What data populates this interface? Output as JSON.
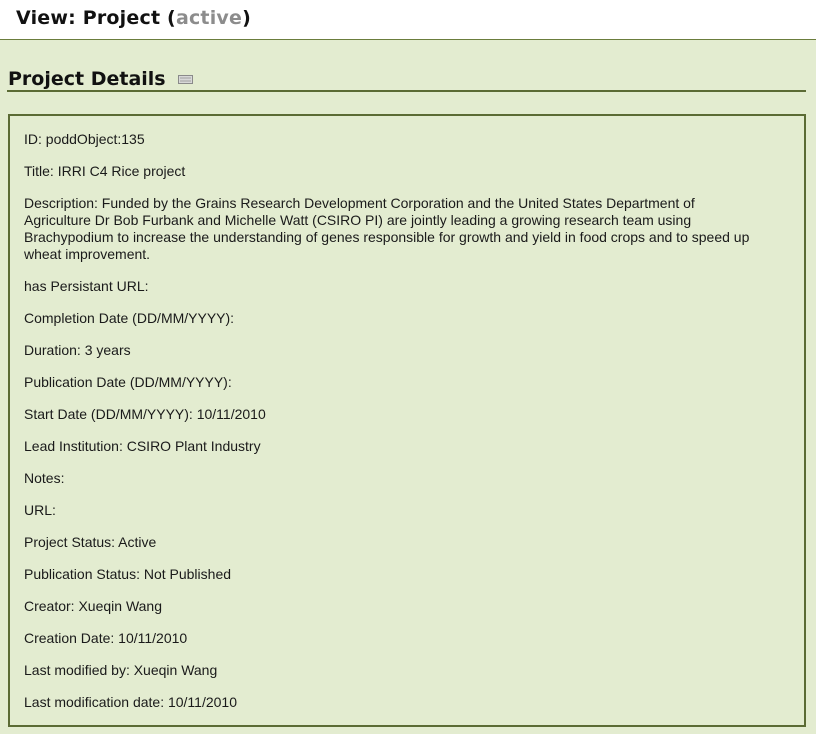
{
  "header": {
    "view_prefix": "View: Project (",
    "status": "active",
    "view_suffix": ")"
  },
  "section": {
    "title": "Project Details",
    "icon": "collapse-icon"
  },
  "details": {
    "id": "ID: poddObject:135",
    "title": "Title: IRRI C4 Rice project",
    "description_line1": "Description: Funded by the Grains Research Development Corporation and the United States Department of",
    "description_line2": "Agriculture Dr Bob Furbank and Michelle Watt (CSIRO PI) are jointly leading a growing research team using",
    "description_line3": "Brachypodium to increase the understanding of genes responsible for growth and yield in food crops and to speed up",
    "description_line4": "wheat improvement.",
    "persistent_url": "has Persistant URL:",
    "completion_date": "Completion Date (DD/MM/YYYY):",
    "duration": "Duration: 3 years",
    "publication_date": "Publication Date (DD/MM/YYYY):",
    "start_date": "Start Date (DD/MM/YYYY): 10/11/2010",
    "lead_institution": "Lead Institution: CSIRO Plant Industry",
    "notes": "Notes:",
    "url": "URL:",
    "project_status": "Project Status: Active",
    "publication_status": "Publication Status: Not Published",
    "creator": "Creator: Xueqin Wang",
    "creation_date": "Creation Date: 10/11/2010",
    "last_modified_by": "Last modified by: Xueqin Wang",
    "last_modification_date": "Last modification date: 10/11/2010"
  },
  "colors": {
    "background": "#e3ecd0",
    "border": "#5b6b34",
    "status_text": "#8c8c8c"
  }
}
